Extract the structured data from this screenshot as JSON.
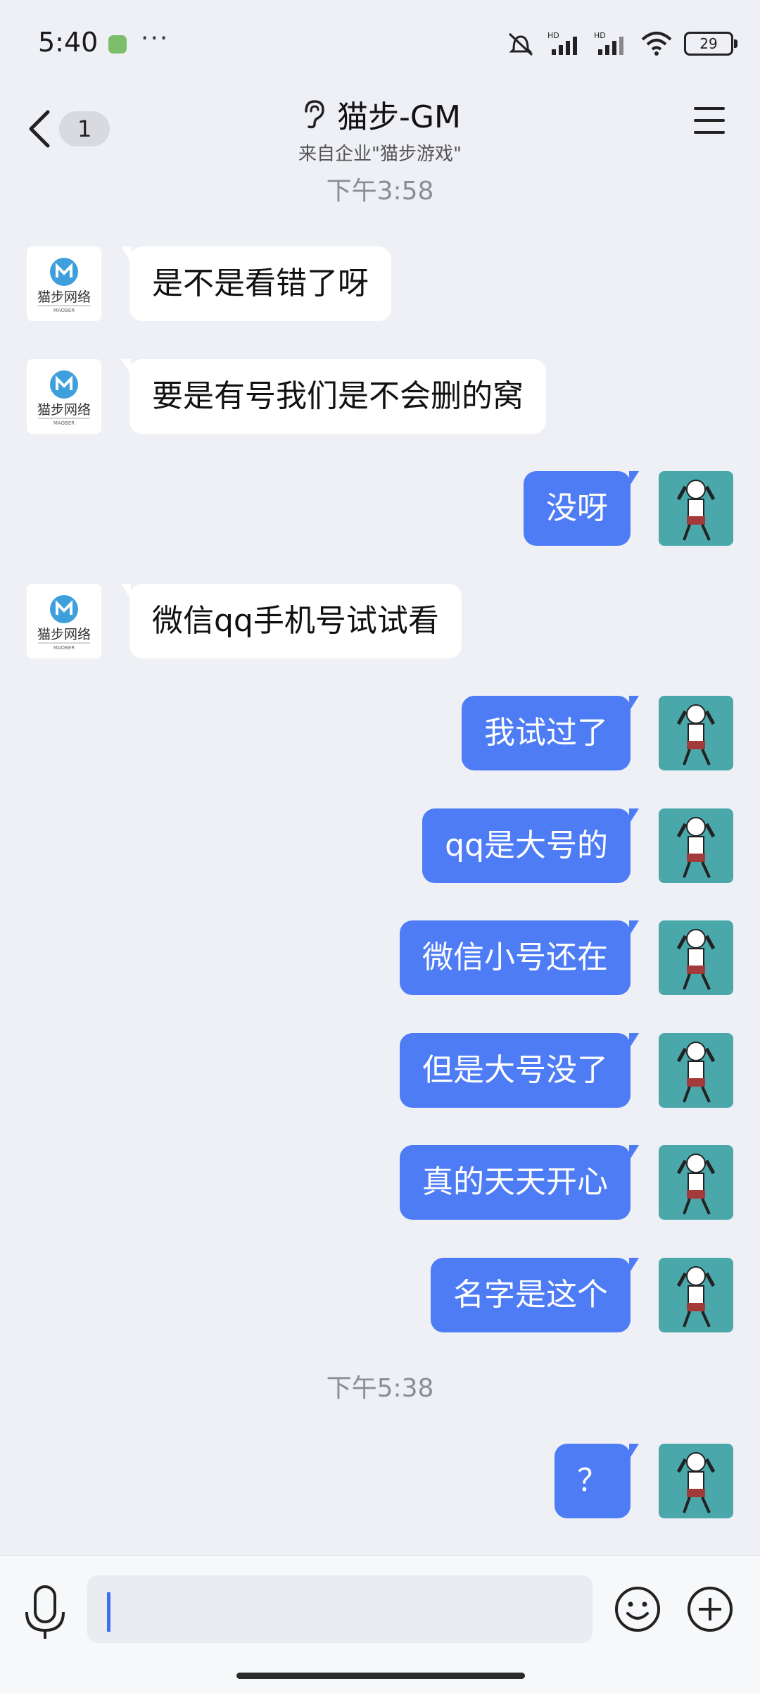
{
  "status": {
    "time": "5:40",
    "more": "···",
    "battery": "29",
    "hd1": "HD",
    "hd2": "HD"
  },
  "header": {
    "unread_count": "1",
    "title": "猫步-GM",
    "subtitle": "来自企业\"猫步游戏\""
  },
  "timestamps": {
    "t1": "下午3:58",
    "t2": "下午5:38"
  },
  "messages": [
    {
      "side": "left",
      "text": "是不是看错了呀"
    },
    {
      "side": "left",
      "text": "要是有号我们是不会删的窝"
    },
    {
      "side": "right",
      "text": "没呀"
    },
    {
      "side": "left",
      "text": "微信qq手机号试试看"
    },
    {
      "side": "right",
      "text": "我试过了"
    },
    {
      "side": "right",
      "text": "qq是大号的"
    },
    {
      "side": "right",
      "text": "微信小号还在"
    },
    {
      "side": "right",
      "text": "但是大号没了"
    },
    {
      "side": "right",
      "text": "真的天天开心"
    },
    {
      "side": "right",
      "text": "名字是这个"
    },
    {
      "side": "right",
      "text": "？"
    }
  ],
  "brand": {
    "logo_text": "猫步网络",
    "logo_subtext": "MAOBER"
  },
  "colors": {
    "accent": "#4e7cf5",
    "background": "#eef0f5",
    "avatar_bg": "#4aa8ab"
  },
  "input": {
    "value": "",
    "placeholder": ""
  }
}
